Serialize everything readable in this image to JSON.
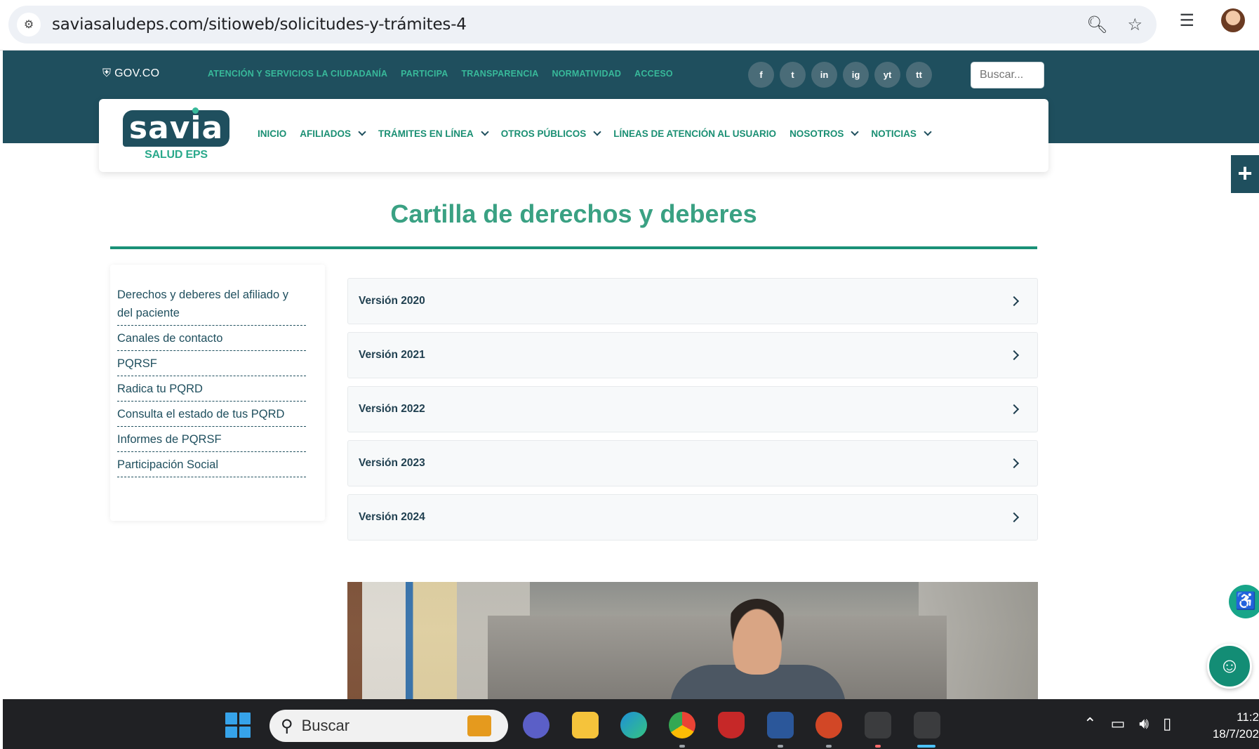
{
  "browser": {
    "url": "saviasaludeps.com/sitioweb/solicitudes-y-trámites-4"
  },
  "gov": {
    "brand": "GOV.CO",
    "links": [
      "ATENCIÓN Y SERVICIOS LA CIUDADANÍA",
      "PARTICIPA",
      "TRANSPARENCIA",
      "NORMATIVIDAD",
      "ACCESO"
    ],
    "socials": [
      "f",
      "t",
      "in",
      "ig",
      "yt",
      "tt"
    ],
    "search_placeholder": "Buscar..."
  },
  "logo": {
    "name": "savia",
    "subtitle": "SALUD EPS"
  },
  "nav": {
    "items": [
      {
        "label": "INICIO",
        "dropdown": false
      },
      {
        "label": "AFILIADOS",
        "dropdown": true
      },
      {
        "label": "TRÁMITES EN LÍNEA",
        "dropdown": true
      },
      {
        "label": "OTROS PÚBLICOS",
        "dropdown": true
      },
      {
        "label": "LÍNEAS DE ATENCIÓN AL USUARIO",
        "dropdown": false
      },
      {
        "label": "NOSOTROS",
        "dropdown": true
      },
      {
        "label": "NOTICIAS",
        "dropdown": true
      }
    ]
  },
  "page": {
    "title": "Cartilla de derechos y deberes"
  },
  "sidebar": {
    "links": [
      "Derechos y deberes del afiliado y del paciente",
      "Canales de contacto",
      "PQRSF",
      "Radica tu PQRD",
      "Consulta el estado de tus PQRD",
      "Informes de PQRSF",
      "Participación Social"
    ]
  },
  "accordion": {
    "items": [
      "Versión 2020",
      "Versión 2021",
      "Versión 2022",
      "Versión 2023",
      "Versión 2024"
    ]
  },
  "taskbar": {
    "search_label": "Buscar",
    "clock_time": "11:2",
    "clock_date": "18/7/202"
  },
  "colors": {
    "brand_dark": "#1f4f5e",
    "brand_green": "#3aa183",
    "link_green": "#38b99a"
  },
  "icons": {
    "site_info": "tune-icon",
    "zoom": "zoom-icon",
    "bookmark": "star-icon",
    "reading_list": "playlist-icon",
    "accessibility": "accessibility-icon",
    "chat": "chat-bot-icon"
  }
}
